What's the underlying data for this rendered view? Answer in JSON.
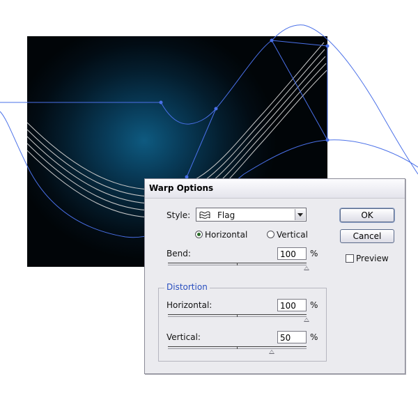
{
  "dialog": {
    "title": "Warp Options",
    "style_label": "Style:",
    "style_value": "Flag",
    "style_icon": "flag-warp-icon",
    "orientation": {
      "horizontal_label": "Horizontal",
      "vertical_label": "Vertical",
      "selected": "Horizontal"
    },
    "bend": {
      "label": "Bend:",
      "value": "100",
      "unit": "%",
      "fraction": 1.0
    },
    "distortion": {
      "group_label": "Distortion",
      "horizontal": {
        "label": "Horizontal:",
        "value": "100",
        "unit": "%",
        "fraction": 1.0
      },
      "vertical": {
        "label": "Vertical:",
        "value": "50",
        "unit": "%",
        "fraction": 0.75
      }
    },
    "buttons": {
      "ok_label": "OK",
      "cancel_label": "Cancel"
    },
    "preview": {
      "label": "Preview",
      "checked": false
    }
  },
  "colors": {
    "artboard_glow": "#0e5a80",
    "artboard_dark": "#010508",
    "envelope_path": "#4a70e8",
    "warped_lines": "#c8c8c8",
    "group_label": "#2a4fbf"
  }
}
